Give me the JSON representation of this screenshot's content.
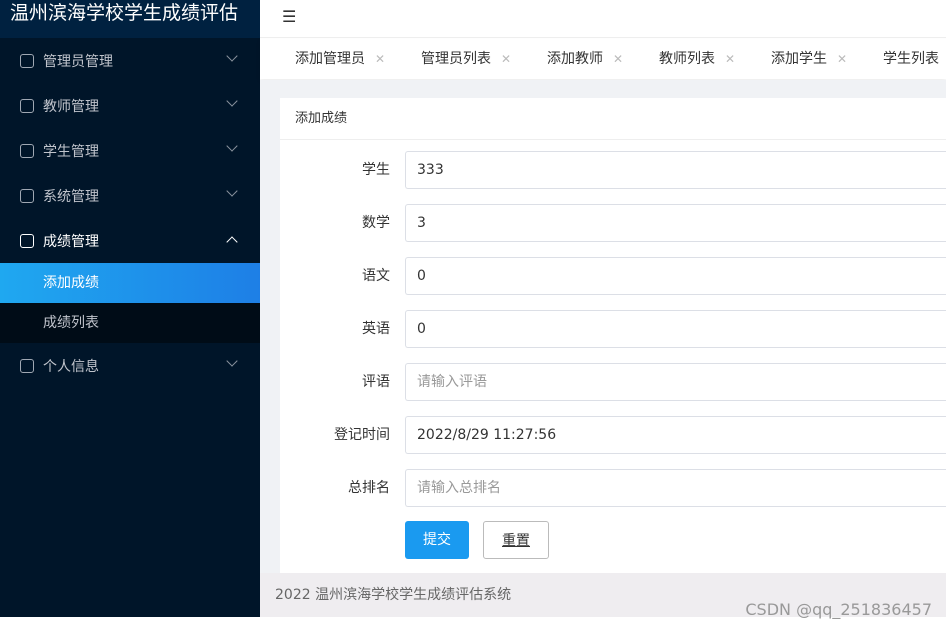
{
  "app": {
    "title": "温州滨海学校学生成绩评估"
  },
  "sidebar": {
    "items": [
      {
        "label": "管理员管理"
      },
      {
        "label": "教师管理"
      },
      {
        "label": "学生管理"
      },
      {
        "label": "系统管理"
      },
      {
        "label": "成绩管理"
      },
      {
        "label": "个人信息"
      }
    ],
    "sub": [
      {
        "label": "添加成绩"
      },
      {
        "label": "成绩列表"
      }
    ]
  },
  "tabs": [
    {
      "label": "添加管理员"
    },
    {
      "label": "管理员列表"
    },
    {
      "label": "添加教师"
    },
    {
      "label": "教师列表"
    },
    {
      "label": "添加学生"
    },
    {
      "label": "学生列表"
    }
  ],
  "form": {
    "title": "添加成绩",
    "fields": [
      {
        "label": "学生",
        "value": "333",
        "placeholder": ""
      },
      {
        "label": "数学",
        "value": "3",
        "placeholder": ""
      },
      {
        "label": "语文",
        "value": "0",
        "placeholder": ""
      },
      {
        "label": "英语",
        "value": "0",
        "placeholder": ""
      },
      {
        "label": "评语",
        "value": "",
        "placeholder": "请输入评语"
      },
      {
        "label": "登记时间",
        "value": "2022/8/29 11:27:56",
        "placeholder": ""
      },
      {
        "label": "总排名",
        "value": "",
        "placeholder": "请输入总排名"
      }
    ],
    "submit": "提交",
    "reset": "重置"
  },
  "footer": "2022 温州滨海学校学生成绩评估系统",
  "watermark": "CSDN @qq_251836457"
}
